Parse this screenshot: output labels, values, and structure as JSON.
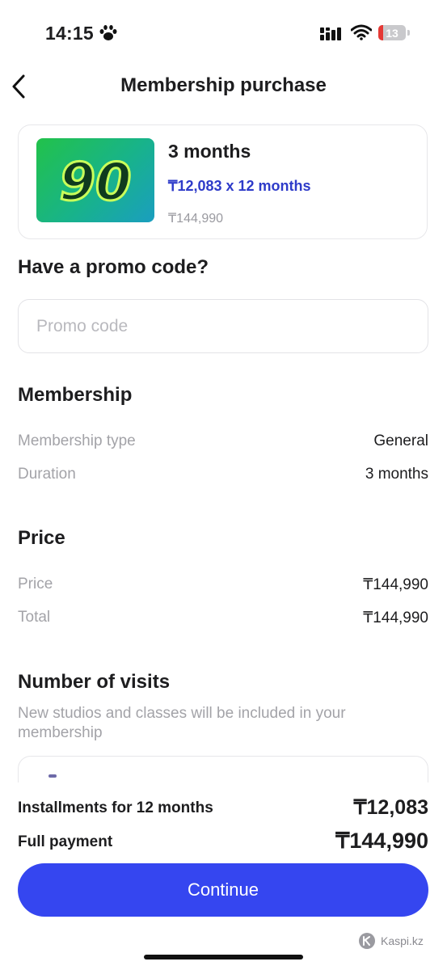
{
  "status_bar": {
    "time": "14:15",
    "battery_level": "13",
    "icons": [
      "paw-icon",
      "signal-icon",
      "wifi-icon",
      "battery-icon"
    ]
  },
  "header": {
    "title": "Membership purchase",
    "back_icon": "chevron-left-icon"
  },
  "product": {
    "image_text": "90",
    "title": "3 months",
    "installment": "₸12,083 x 12 months",
    "price": "₸144,990"
  },
  "promo": {
    "heading": "Have a promo code?",
    "placeholder": "Promo code",
    "value": ""
  },
  "membership": {
    "heading": "Membership",
    "rows": [
      {
        "label": "Membership type",
        "value": "General"
      },
      {
        "label": "Duration",
        "value": "3 months"
      }
    ]
  },
  "price": {
    "heading": "Price",
    "rows": [
      {
        "label": "Price",
        "value": "₸144,990"
      },
      {
        "label": "Total",
        "value": "₸144,990"
      }
    ]
  },
  "visits": {
    "heading": "Number of visits",
    "description": "New studios and classes will be included in your membership"
  },
  "payment": {
    "installments_label": "Installments for 12 months",
    "installments_value": "₸12,083",
    "full_label": "Full payment",
    "full_value": "₸144,990"
  },
  "actions": {
    "continue_label": "Continue"
  },
  "watermark": {
    "text": "Kaspi.kz"
  },
  "colors": {
    "accent": "#3546f0",
    "installment_text": "#2e3bc9",
    "muted_text": "#a3a3a8"
  }
}
